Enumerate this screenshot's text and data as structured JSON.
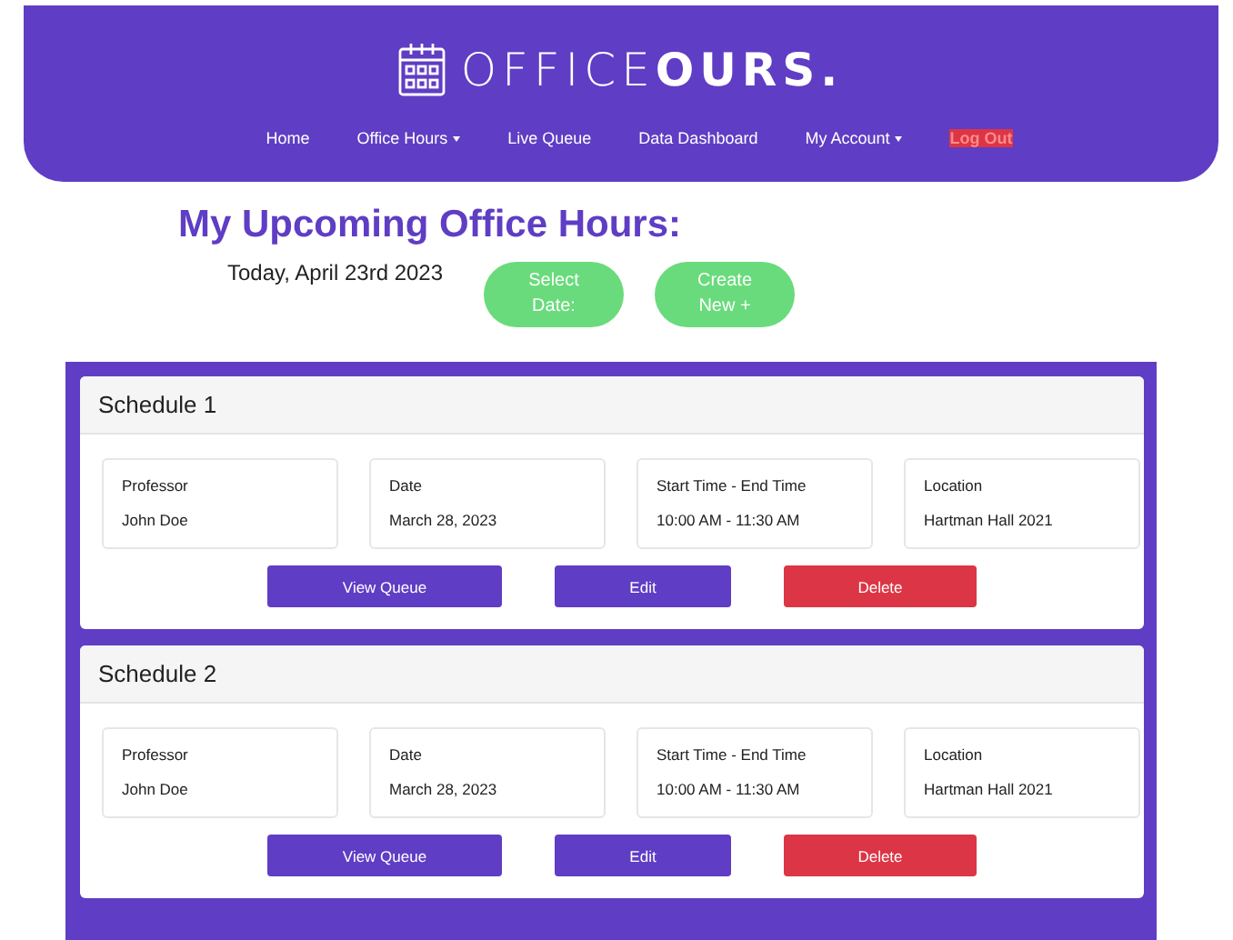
{
  "header": {
    "logo": "OFFICE**OURS.**",
    "nav": [
      {
        "label": "Home",
        "kind": "link"
      },
      {
        "label": "Office Hours",
        "kind": "dropdown"
      },
      {
        "label": "Live Queue",
        "kind": "link"
      },
      {
        "label": "Data Dashboard",
        "kind": "link"
      },
      {
        "label": "My Account",
        "kind": "dropdown"
      },
      {
        "label": "Log Out",
        "kind": "danger"
      }
    ]
  },
  "page_title": "My Upcoming Office Hours:",
  "today": "Today, April 23rd 2023",
  "actions": [
    "Select Date:",
    "Create New +"
  ],
  "schedules": [
    {
      "title": "Schedule 1",
      "fields": [
        {
          "label": "Professor",
          "value": "John Doe"
        },
        {
          "label": "Date",
          "value": "March 28, 2023"
        },
        {
          "label": "Start Time - End Time",
          "value": "10:00 AM - 11:30 AM"
        },
        {
          "label": "Location",
          "value": "Hartman Hall 2021"
        }
      ],
      "buttons": [
        {
          "label": "View Queue",
          "kind": "primary"
        },
        {
          "label": "Edit",
          "kind": "primary"
        },
        {
          "label": "Delete",
          "kind": "danger"
        }
      ]
    },
    {
      "title": "Schedule 2",
      "fields": [
        {
          "label": "Professor",
          "value": "John Doe"
        },
        {
          "label": "Date",
          "value": "March 28, 2023"
        },
        {
          "label": "Start Time - End Time",
          "value": "10:00 AM - 11:30 AM"
        },
        {
          "label": "Location",
          "value": "Hartman Hall 2021"
        }
      ],
      "buttons": [
        {
          "label": "View Queue",
          "kind": "primary"
        },
        {
          "label": "Edit",
          "kind": "primary"
        },
        {
          "label": "Delete",
          "kind": "danger"
        }
      ]
    }
  ]
}
